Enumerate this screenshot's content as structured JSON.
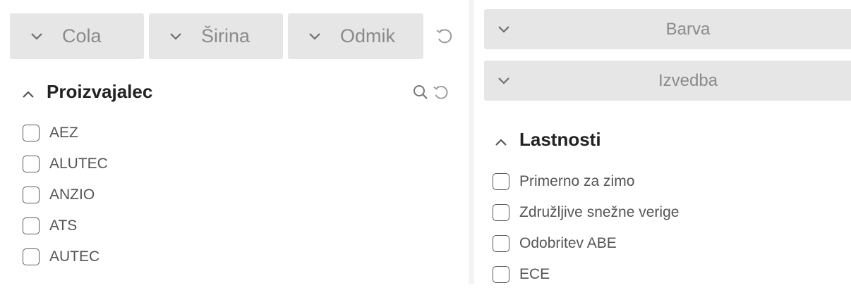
{
  "left_panel": {
    "chips": [
      {
        "label": "Cola"
      },
      {
        "label": "Širina"
      },
      {
        "label": "Odmik"
      }
    ],
    "manufacturer": {
      "title": "Proizvajalec",
      "items": [
        "AEZ",
        "ALUTEC",
        "ANZIO",
        "ATS",
        "AUTEC"
      ]
    }
  },
  "right_panel": {
    "accordions": [
      {
        "label": "Barva"
      },
      {
        "label": "Izvedba"
      }
    ],
    "properties": {
      "title": "Lastnosti",
      "items": [
        "Primerno za zimo",
        "Združljive snežne verige",
        "Odobritev ABE",
        "ECE"
      ]
    }
  },
  "icons": {
    "chevron_down": "chevron-down-icon",
    "chevron_up": "chevron-up-icon",
    "reset": "reset-icon",
    "search": "search-icon"
  },
  "colors": {
    "chip_bg": "#e6e6e6",
    "chip_text": "#8a8a8a",
    "title_text": "#222222",
    "item_text": "#555555"
  }
}
